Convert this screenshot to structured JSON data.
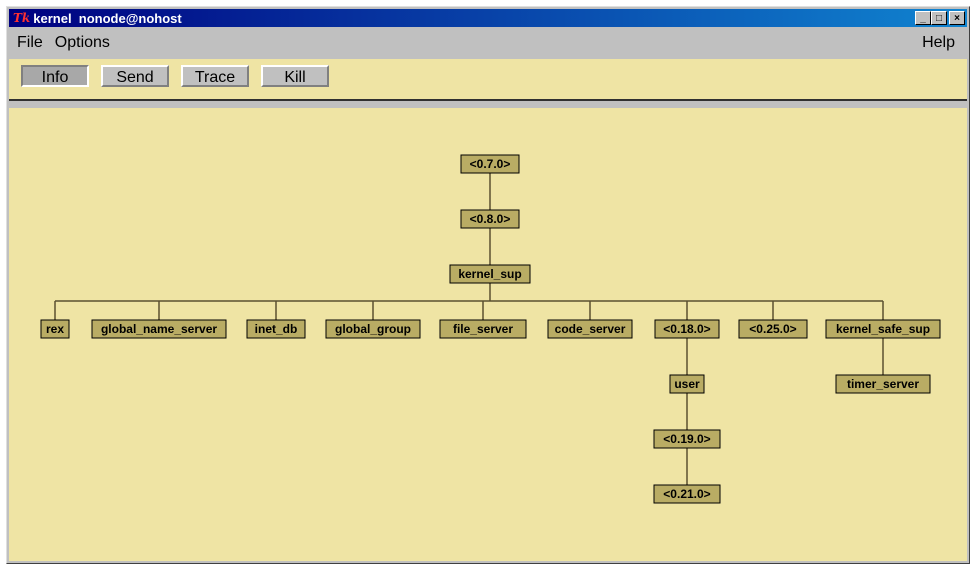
{
  "window": {
    "title": "kernel  nonode@nohost",
    "logo": "Tk",
    "controls": {
      "minimize": "_",
      "maximize": "□",
      "close": "×"
    }
  },
  "menubar": {
    "items": [
      "File",
      "Options"
    ],
    "help": "Help"
  },
  "toolbar": {
    "buttons": [
      {
        "label": "Info",
        "active": true
      },
      {
        "label": "Send",
        "active": false
      },
      {
        "label": "Trace",
        "active": false
      },
      {
        "label": "Kill",
        "active": false
      }
    ]
  },
  "colors": {
    "canvas_bg": "#efe4a4",
    "node_fill": "#b9ac64",
    "titlebar_start": "#000080",
    "titlebar_end": "#1084d0"
  },
  "tree": {
    "root": {
      "label": "<0.7.0>",
      "children": [
        {
          "label": "<0.8.0>",
          "children": [
            {
              "label": "kernel_sup",
              "children": [
                {
                  "label": "rex"
                },
                {
                  "label": "global_name_server"
                },
                {
                  "label": "inet_db"
                },
                {
                  "label": "global_group"
                },
                {
                  "label": "file_server"
                },
                {
                  "label": "code_server"
                },
                {
                  "label": "<0.18.0>",
                  "children": [
                    {
                      "label": "user",
                      "children": [
                        {
                          "label": "<0.19.0>",
                          "children": [
                            {
                              "label": "<0.21.0>"
                            }
                          ]
                        }
                      ]
                    }
                  ]
                },
                {
                  "label": "<0.25.0>"
                },
                {
                  "label": "kernel_safe_sup",
                  "children": [
                    {
                      "label": "timer_server"
                    }
                  ]
                }
              ]
            }
          ]
        }
      ]
    }
  }
}
